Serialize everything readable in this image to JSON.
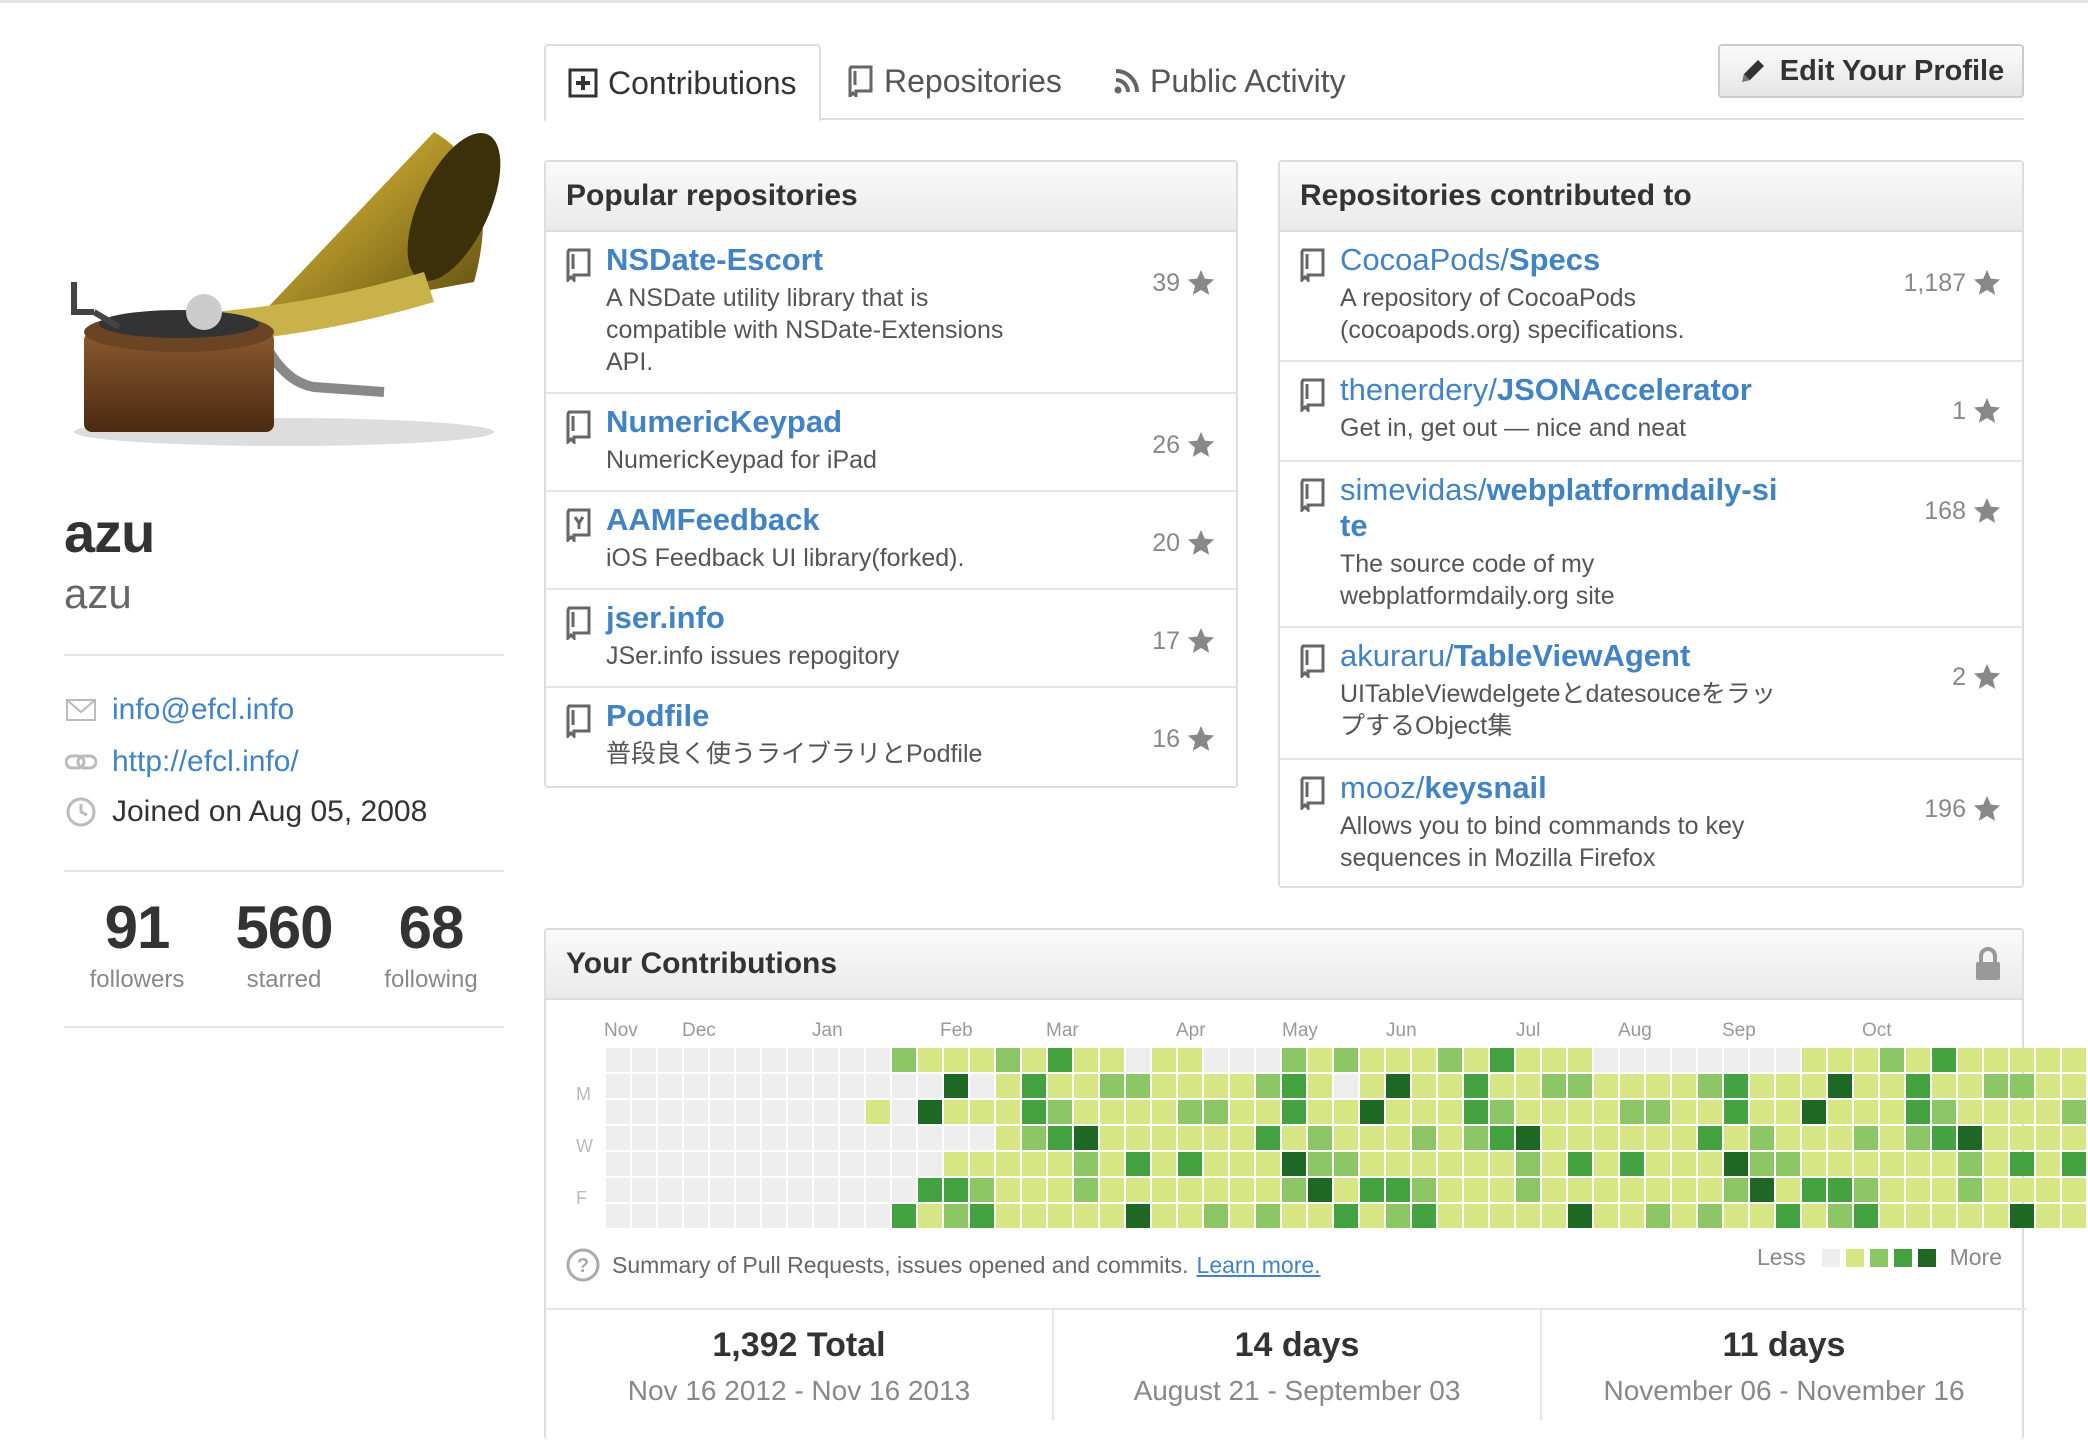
{
  "profile": {
    "fullname": "azu",
    "username": "azu",
    "email": "info@efcl.info",
    "website": "http://efcl.info/",
    "joined": "Joined on Aug 05, 2008",
    "stats": [
      {
        "num": "91",
        "label": "followers"
      },
      {
        "num": "560",
        "label": "starred"
      },
      {
        "num": "68",
        "label": "following"
      }
    ]
  },
  "tabs": {
    "contributions": "Contributions",
    "repositories": "Repositories",
    "public_activity": "Public Activity"
  },
  "edit_profile_label": "Edit Your Profile",
  "popular": {
    "title": "Popular repositories",
    "repos": [
      {
        "name": "NSDate-Escort",
        "desc1": "A NSDate utility library that is",
        "desc2": "compatible with NSDate-Extensions",
        "desc3": "API.",
        "stars": "39"
      },
      {
        "name": "NumericKeypad",
        "desc1": "NumericKeypad for iPad",
        "stars": "26"
      },
      {
        "name": "AAMFeedback",
        "desc1": "iOS Feedback UI library(forked).",
        "stars": "20"
      },
      {
        "name": "jser.info",
        "desc1": "JSer.info issues repogitory",
        "stars": "17"
      },
      {
        "name": "Podfile",
        "desc1": "普段良く使うライブラリとPodfile",
        "stars": "16"
      }
    ]
  },
  "contributed": {
    "title": "Repositories contributed to",
    "repos": [
      {
        "owner": "CocoaPods/",
        "name": "Specs",
        "desc1": "A repository of CocoaPods",
        "desc2": "(cocoapods.org) specifications.",
        "stars": "1,187"
      },
      {
        "owner": "thenerdery/",
        "name": "JSONAccelerator",
        "desc1": "Get in, get out — nice and neat",
        "stars": "1"
      },
      {
        "owner": "simevidas/",
        "name": "webplatformdaily-si",
        "name2": "te",
        "desc1": "The source code of my",
        "desc2": "webplatformdaily.org site",
        "stars": "168"
      },
      {
        "owner": "akuraru/",
        "name": "TableViewAgent",
        "desc1": "UITableViewdelgeteとdatesouceをラッ",
        "desc2": "プするObject集",
        "stars": "2"
      },
      {
        "owner": "mooz/",
        "name": "keysnail",
        "desc1": "Allows you to bind commands to key",
        "desc2": "sequences in Mozilla Firefox",
        "stars": "196"
      }
    ]
  },
  "contrib": {
    "title": "Your Contributions",
    "months": [
      "Nov",
      "Dec",
      "Jan",
      "Feb",
      "Mar",
      "Apr",
      "May",
      "Jun",
      "Jul",
      "Aug",
      "Sep",
      "Oct"
    ],
    "days": [
      "M",
      "W",
      "F"
    ],
    "summary": "Summary of Pull Requests, issues opened and commits.",
    "learn_more": "Learn more.",
    "less": "Less",
    "more": "More",
    "colors": [
      "#eeeeee",
      "#d6e685",
      "#8cc665",
      "#44a340",
      "#1e6823"
    ],
    "levels": [
      "0000000000011111111101100011111111111100000000111111111110000",
      "0000000000000101111111111111011111111111111111111111111111110",
      "0000000000101111111111111111111111111111111111111111111111111",
      "0000000000000001111111111111111111111111111111111111111111111",
      "0000000000000111111111111111111111111111111111111111111111111",
      "0000000000001111111111111111111111111111111111111111111111111",
      "0000000000011111111111111111111111111111111111111111111111111"
    ],
    "totals": [
      {
        "big": "1,392 Total",
        "range": "Nov 16 2012 - Nov 16 2013"
      },
      {
        "big": "14 days",
        "range": "August 21 - September 03"
      },
      {
        "big": "11 days",
        "range": "November 06 - November 16"
      }
    ]
  }
}
